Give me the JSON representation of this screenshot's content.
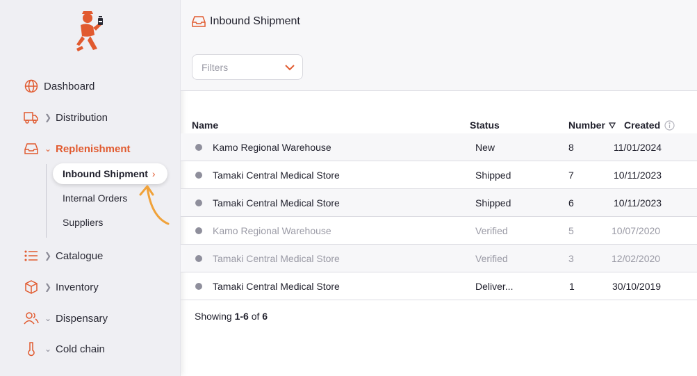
{
  "colors": {
    "accent": "#e15a2f",
    "annotation": "#f0a23a",
    "dot": "#8f8f9c"
  },
  "sidebar": {
    "items": [
      {
        "label": "Dashboard",
        "icon": "globe-icon"
      },
      {
        "label": "Distribution",
        "icon": "truck-icon"
      },
      {
        "label": "Replenishment",
        "icon": "inbox-icon"
      },
      {
        "label": "Catalogue",
        "icon": "list-icon"
      },
      {
        "label": "Inventory",
        "icon": "box-icon"
      },
      {
        "label": "Dispensary",
        "icon": "users-icon"
      },
      {
        "label": "Cold chain",
        "icon": "thermometer-icon"
      }
    ],
    "subitems": [
      {
        "label": "Inbound Shipment",
        "active": true
      },
      {
        "label": "Internal Orders"
      },
      {
        "label": "Suppliers"
      }
    ]
  },
  "header": {
    "title": "Inbound Shipment",
    "filters_placeholder": "Filters"
  },
  "table": {
    "columns": {
      "name": "Name",
      "status": "Status",
      "number": "Number",
      "created": "Created"
    },
    "rows": [
      {
        "name": "Kamo Regional Warehouse",
        "status": "New",
        "number": "8",
        "created": "11/01/2024"
      },
      {
        "name": "Tamaki Central Medical Store",
        "status": "Shipped",
        "number": "7",
        "created": "10/11/2023"
      },
      {
        "name": "Tamaki Central Medical Store",
        "status": "Shipped",
        "number": "6",
        "created": "10/11/2023"
      },
      {
        "name": "Kamo Regional Warehouse",
        "status": "Verified",
        "number": "5",
        "created": "10/07/2020"
      },
      {
        "name": "Tamaki Central Medical Store",
        "status": "Verified",
        "number": "3",
        "created": "12/02/2020"
      },
      {
        "name": "Tamaki Central Medical Store",
        "status": "Deliver...",
        "number": "1",
        "created": "30/10/2019"
      }
    ]
  },
  "footer": {
    "prefix": "Showing",
    "range": "1-6",
    "of": "of",
    "total": "6"
  }
}
